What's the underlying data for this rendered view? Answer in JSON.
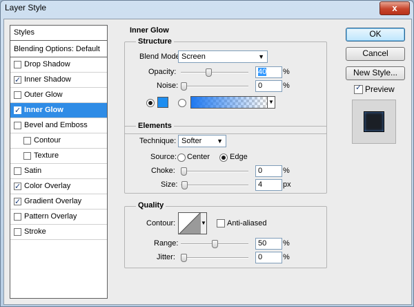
{
  "window": {
    "title": "Layer Style",
    "close_glyph": "x"
  },
  "sidebar": {
    "header": "Styles",
    "blending_default": "Blending Options: Default",
    "items": [
      {
        "label": "Drop Shadow",
        "checked": false,
        "sub": false,
        "selected": false
      },
      {
        "label": "Inner Shadow",
        "checked": true,
        "sub": false,
        "selected": false
      },
      {
        "label": "Outer Glow",
        "checked": false,
        "sub": false,
        "selected": false
      },
      {
        "label": "Inner Glow",
        "checked": true,
        "sub": false,
        "selected": true
      },
      {
        "label": "Bevel and Emboss",
        "checked": false,
        "sub": false,
        "selected": false
      },
      {
        "label": "Contour",
        "checked": false,
        "sub": true,
        "selected": false
      },
      {
        "label": "Texture",
        "checked": false,
        "sub": true,
        "selected": false
      },
      {
        "label": "Satin",
        "checked": false,
        "sub": false,
        "selected": false
      },
      {
        "label": "Color Overlay",
        "checked": true,
        "sub": false,
        "selected": false
      },
      {
        "label": "Gradient Overlay",
        "checked": true,
        "sub": false,
        "selected": false
      },
      {
        "label": "Pattern Overlay",
        "checked": false,
        "sub": false,
        "selected": false
      },
      {
        "label": "Stroke",
        "checked": false,
        "sub": false,
        "selected": false
      }
    ]
  },
  "buttons": {
    "ok": "OK",
    "cancel": "Cancel",
    "new_style": "New Style...",
    "preview": "Preview"
  },
  "inner_glow": {
    "title": "Inner Glow",
    "structure": {
      "title": "Structure",
      "blend_mode_label": "Blend Mode:",
      "blend_mode_value": "Screen",
      "opacity_label": "Opacity:",
      "opacity_value": "40",
      "opacity_unit": "%",
      "noise_label": "Noise:",
      "noise_value": "0",
      "noise_unit": "%",
      "glow_color": "#1e8ef0"
    },
    "elements": {
      "title": "Elements",
      "technique_label": "Technique:",
      "technique_value": "Softer",
      "source_label": "Source:",
      "source_center": "Center",
      "source_edge": "Edge",
      "choke_label": "Choke:",
      "choke_value": "0",
      "choke_unit": "%",
      "size_label": "Size:",
      "size_value": "4",
      "size_unit": "px"
    },
    "quality": {
      "title": "Quality",
      "contour_label": "Contour:",
      "anti_aliased_label": "Anti-aliased",
      "range_label": "Range:",
      "range_value": "50",
      "range_unit": "%",
      "jitter_label": "Jitter:",
      "jitter_value": "0",
      "jitter_unit": "%"
    }
  }
}
